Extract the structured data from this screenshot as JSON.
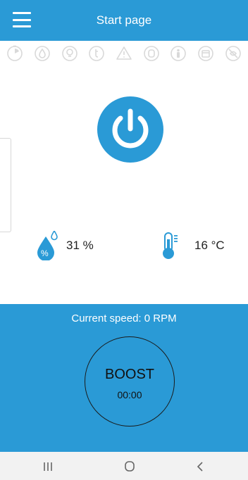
{
  "header": {
    "title": "Start page",
    "menu_icon": "hamburger-menu-icon"
  },
  "status_icons": [
    "timer-icon",
    "water-drop-icon",
    "bulb-icon",
    "temperature-icon",
    "warning-icon",
    "filter-icon",
    "person-icon",
    "calendar-icon",
    "fan-off-icon"
  ],
  "main": {
    "power_icon": "power-icon",
    "humidity": {
      "icon": "humidity-icon",
      "value": "31 %"
    },
    "temperature": {
      "icon": "thermometer-icon",
      "value": "16 °C"
    }
  },
  "speed_panel": {
    "speed_text": "Current speed: 0 RPM",
    "boost_label": "BOOST",
    "boost_time": "00:00"
  },
  "system_nav": {
    "recents": "recents-icon",
    "home": "home-icon",
    "back": "back-icon"
  },
  "colors": {
    "accent": "#2a9ad6",
    "status_icon": "#d9d9d9",
    "nav_bg": "#f2f2f2"
  }
}
